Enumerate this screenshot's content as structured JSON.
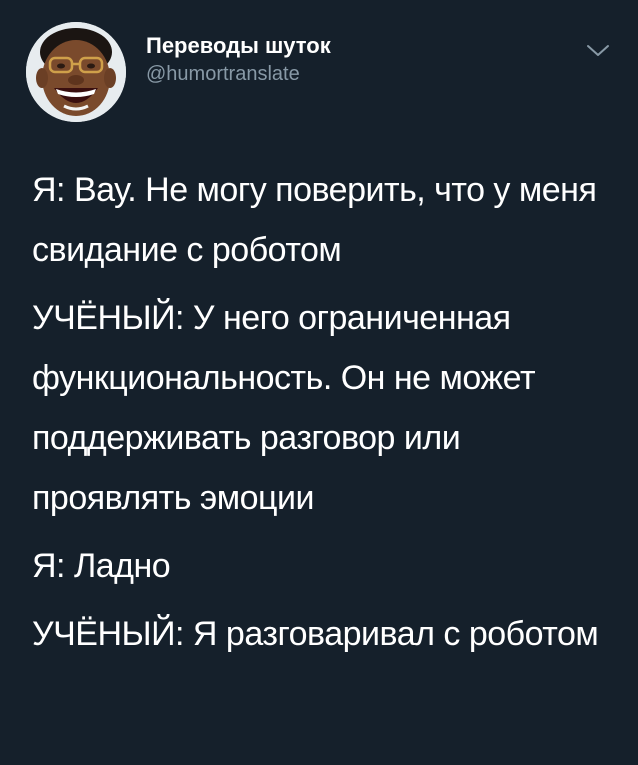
{
  "author": {
    "display_name": "Переводы шуток",
    "handle": "@humortranslate",
    "avatar_icon": "laughing-man-avatar-icon"
  },
  "menu": {
    "icon": "chevron-down-icon"
  },
  "tweet": {
    "paragraphs": [
      "Я: Вау. Не могу поверить, что у меня свидание с роботом",
      "УЧЁНЫЙ: У него ограниченная функциональность. Он не может поддерживать разговор или проявлять эмоции",
      "Я: Ладно",
      "УЧЁНЫЙ: Я разговаривал с роботом"
    ]
  },
  "colors": {
    "background": "#15202b",
    "text": "#ffffff",
    "secondary_text": "#8899a6"
  }
}
